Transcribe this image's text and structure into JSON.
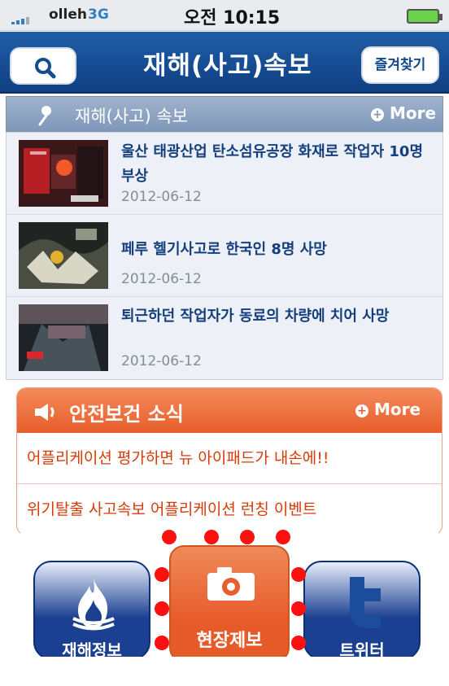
{
  "status_bar": {
    "carrier": "olleh",
    "network": "3G",
    "time": "오전 10:15"
  },
  "header": {
    "title": "재해(사고)속보",
    "favorites_label": "즐겨찾기"
  },
  "accident_section": {
    "title": "재해(사고) 속보",
    "more_label": "More",
    "items": [
      {
        "title": "울산 태광산업 탄소섬유공장 화재로 작업자 10명 부상",
        "date": "2012-06-12"
      },
      {
        "title": "페루 헬기사고로 한국인 8명 사망",
        "date": "2012-06-12"
      },
      {
        "title": "퇴근하던 작업자가 동료의 차량에 치어 사망",
        "date": "2012-06-12"
      }
    ]
  },
  "safety_section": {
    "title": "안전보건 소식",
    "more_label": "More",
    "items": [
      {
        "text": "어플리케이션 평가하면 뉴 아이패드가 내손에!!"
      },
      {
        "text": "위기탈출 사고속보 어플리케이션 런칭 이벤트"
      }
    ]
  },
  "bottom_nav": {
    "left": "재해정보",
    "center": "현장제보",
    "right": "트위터"
  },
  "colors": {
    "header_blue": "#0f3f82",
    "section_gray_blue": "#7f97b9",
    "accent_orange": "#e85d2b",
    "focus_red": "#ff1010"
  },
  "icons": {
    "search": "search-icon",
    "pin": "pin-icon",
    "more": "plus-circle-icon",
    "speaker": "speaker-icon",
    "fire": "fire-icon",
    "camera": "camera-icon",
    "twitter": "twitter-icon"
  }
}
